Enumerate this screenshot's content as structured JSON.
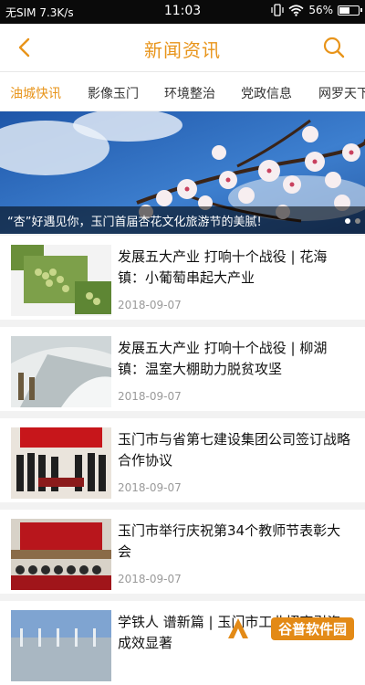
{
  "status_bar": {
    "carrier": "无SIM 7.3K/s",
    "time": "11:03",
    "battery": "56%",
    "battery_level": 0.56,
    "icons": [
      "vibrate-icon",
      "wifi-icon",
      "battery-icon"
    ]
  },
  "header": {
    "title": "新闻资讯",
    "accent_color": "#e8941a"
  },
  "tabs": [
    {
      "label": "油城快讯",
      "active": true
    },
    {
      "label": "影像玉门",
      "active": false
    },
    {
      "label": "环境整治",
      "active": false
    },
    {
      "label": "党政信息",
      "active": false
    },
    {
      "label": "网罗天下",
      "active": false
    }
  ],
  "banner": {
    "caption": "“杏”好遇见你，玉门首届杏花文化旅游节的美腻!",
    "dot_count": 2,
    "active_dot": 0
  },
  "news": [
    {
      "title": "发展五大产业 打响十个战役 | 花海镇：小葡萄串起大产业",
      "date": "2018-09-07"
    },
    {
      "title": "发展五大产业 打响十个战役 | 柳湖镇：温室大棚助力脱贫攻坚",
      "date": "2018-09-07"
    },
    {
      "title": "玉门市与省第七建设集团公司签订战略合作协议",
      "date": "2018-09-07"
    },
    {
      "title": "玉门市举行庆祝第34个教师节表彰大会",
      "date": "2018-09-07"
    },
    {
      "title": "学铁人 谱新篇 | 玉门市工业招商引资成效显著",
      "date": ""
    }
  ],
  "watermark": {
    "text": "谷普软件园"
  }
}
